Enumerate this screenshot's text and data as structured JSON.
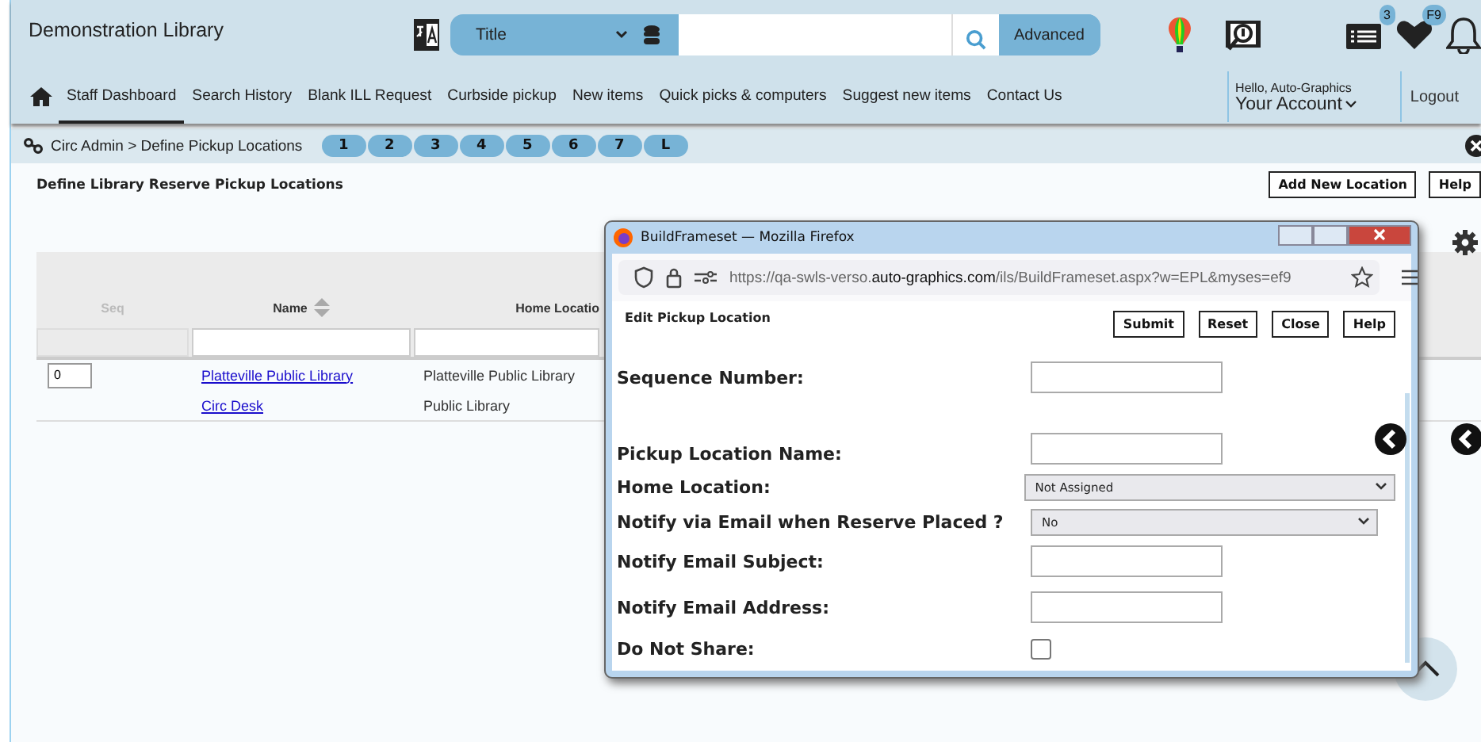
{
  "header": {
    "library_name": "Demonstration Library",
    "search": {
      "field": "Title",
      "button": "Advanced"
    },
    "badges": {
      "list": "3",
      "favorites": "F9"
    }
  },
  "nav": {
    "items": [
      {
        "label": "Staff Dashboard",
        "selected": true
      },
      {
        "label": "Search History",
        "selected": false
      },
      {
        "label": "Blank ILL Request",
        "selected": false
      },
      {
        "label": "Curbside pickup",
        "selected": false
      },
      {
        "label": "New items",
        "selected": false
      },
      {
        "label": "Quick picks & computers",
        "selected": false
      },
      {
        "label": "Suggest new items",
        "selected": false
      },
      {
        "label": "Contact Us",
        "selected": false
      }
    ],
    "greeting": "Hello, Auto-Graphics",
    "account": "Your Account",
    "logout": "Logout"
  },
  "breadcrumb": "Circ Admin > Define Pickup Locations",
  "pages": [
    "1",
    "2",
    "3",
    "4",
    "5",
    "6",
    "7",
    "L"
  ],
  "page_title": "Define Library Reserve Pickup Locations",
  "toolbar_buttons": [
    "Add New Location",
    "Help"
  ],
  "table": {
    "columns": [
      {
        "label": "Seq",
        "disabled": true,
        "sortable": false
      },
      {
        "label": "Name",
        "disabled": false,
        "sortable": true
      },
      {
        "label": "Home Locatio",
        "disabled": false,
        "sortable": false
      }
    ],
    "rows": [
      {
        "seq": "0",
        "name": "Platteville Public Library",
        "home": "Platteville Public Library"
      },
      {
        "name": "Circ Desk",
        "home": "Public Library"
      }
    ]
  },
  "popup": {
    "title": "BuildFrameset — Mozilla Firefox",
    "url": {
      "prefix": "https://qa-swls-verso.",
      "domain": "auto-graphics.com",
      "path": "/ils/BuildFrameset.aspx?w=EPL&myses=ef9"
    },
    "heading": "Edit Pickup Location",
    "buttons": [
      "Submit",
      "Reset",
      "Close",
      "Help"
    ],
    "fields": [
      {
        "label": "Sequence Number:",
        "kind": "text"
      },
      {
        "label": "Pickup Location Name:",
        "kind": "text"
      },
      {
        "label": "Home Location:",
        "kind": "select",
        "value": "Not Assigned"
      },
      {
        "label": "Notify via Email when Reserve Placed ?",
        "kind": "select",
        "value": "No"
      },
      {
        "label": "Notify Email Subject:",
        "kind": "text"
      },
      {
        "label": "Notify Email Address:",
        "kind": "text"
      },
      {
        "label": "Do Not Share:",
        "kind": "checkbox",
        "checked": false
      }
    ]
  }
}
